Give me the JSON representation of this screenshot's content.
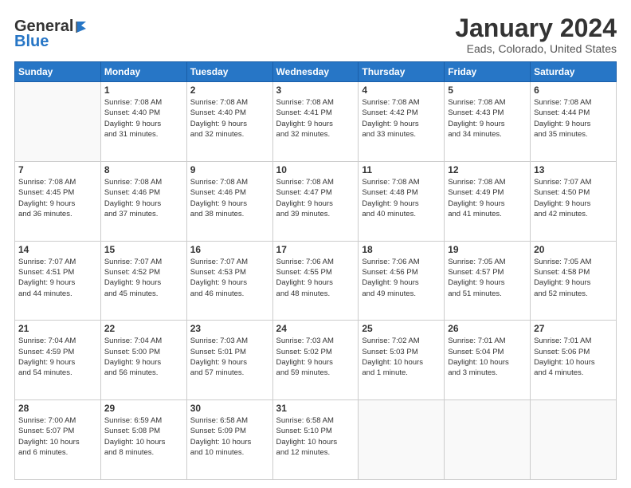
{
  "logo": {
    "general": "General",
    "blue": "Blue"
  },
  "title": "January 2024",
  "subtitle": "Eads, Colorado, United States",
  "days_header": [
    "Sunday",
    "Monday",
    "Tuesday",
    "Wednesday",
    "Thursday",
    "Friday",
    "Saturday"
  ],
  "weeks": [
    [
      {
        "num": "",
        "info": ""
      },
      {
        "num": "1",
        "info": "Sunrise: 7:08 AM\nSunset: 4:40 PM\nDaylight: 9 hours\nand 31 minutes."
      },
      {
        "num": "2",
        "info": "Sunrise: 7:08 AM\nSunset: 4:40 PM\nDaylight: 9 hours\nand 32 minutes."
      },
      {
        "num": "3",
        "info": "Sunrise: 7:08 AM\nSunset: 4:41 PM\nDaylight: 9 hours\nand 32 minutes."
      },
      {
        "num": "4",
        "info": "Sunrise: 7:08 AM\nSunset: 4:42 PM\nDaylight: 9 hours\nand 33 minutes."
      },
      {
        "num": "5",
        "info": "Sunrise: 7:08 AM\nSunset: 4:43 PM\nDaylight: 9 hours\nand 34 minutes."
      },
      {
        "num": "6",
        "info": "Sunrise: 7:08 AM\nSunset: 4:44 PM\nDaylight: 9 hours\nand 35 minutes."
      }
    ],
    [
      {
        "num": "7",
        "info": "Sunrise: 7:08 AM\nSunset: 4:45 PM\nDaylight: 9 hours\nand 36 minutes."
      },
      {
        "num": "8",
        "info": "Sunrise: 7:08 AM\nSunset: 4:46 PM\nDaylight: 9 hours\nand 37 minutes."
      },
      {
        "num": "9",
        "info": "Sunrise: 7:08 AM\nSunset: 4:46 PM\nDaylight: 9 hours\nand 38 minutes."
      },
      {
        "num": "10",
        "info": "Sunrise: 7:08 AM\nSunset: 4:47 PM\nDaylight: 9 hours\nand 39 minutes."
      },
      {
        "num": "11",
        "info": "Sunrise: 7:08 AM\nSunset: 4:48 PM\nDaylight: 9 hours\nand 40 minutes."
      },
      {
        "num": "12",
        "info": "Sunrise: 7:08 AM\nSunset: 4:49 PM\nDaylight: 9 hours\nand 41 minutes."
      },
      {
        "num": "13",
        "info": "Sunrise: 7:07 AM\nSunset: 4:50 PM\nDaylight: 9 hours\nand 42 minutes."
      }
    ],
    [
      {
        "num": "14",
        "info": "Sunrise: 7:07 AM\nSunset: 4:51 PM\nDaylight: 9 hours\nand 44 minutes."
      },
      {
        "num": "15",
        "info": "Sunrise: 7:07 AM\nSunset: 4:52 PM\nDaylight: 9 hours\nand 45 minutes."
      },
      {
        "num": "16",
        "info": "Sunrise: 7:07 AM\nSunset: 4:53 PM\nDaylight: 9 hours\nand 46 minutes."
      },
      {
        "num": "17",
        "info": "Sunrise: 7:06 AM\nSunset: 4:55 PM\nDaylight: 9 hours\nand 48 minutes."
      },
      {
        "num": "18",
        "info": "Sunrise: 7:06 AM\nSunset: 4:56 PM\nDaylight: 9 hours\nand 49 minutes."
      },
      {
        "num": "19",
        "info": "Sunrise: 7:05 AM\nSunset: 4:57 PM\nDaylight: 9 hours\nand 51 minutes."
      },
      {
        "num": "20",
        "info": "Sunrise: 7:05 AM\nSunset: 4:58 PM\nDaylight: 9 hours\nand 52 minutes."
      }
    ],
    [
      {
        "num": "21",
        "info": "Sunrise: 7:04 AM\nSunset: 4:59 PM\nDaylight: 9 hours\nand 54 minutes."
      },
      {
        "num": "22",
        "info": "Sunrise: 7:04 AM\nSunset: 5:00 PM\nDaylight: 9 hours\nand 56 minutes."
      },
      {
        "num": "23",
        "info": "Sunrise: 7:03 AM\nSunset: 5:01 PM\nDaylight: 9 hours\nand 57 minutes."
      },
      {
        "num": "24",
        "info": "Sunrise: 7:03 AM\nSunset: 5:02 PM\nDaylight: 9 hours\nand 59 minutes."
      },
      {
        "num": "25",
        "info": "Sunrise: 7:02 AM\nSunset: 5:03 PM\nDaylight: 10 hours\nand 1 minute."
      },
      {
        "num": "26",
        "info": "Sunrise: 7:01 AM\nSunset: 5:04 PM\nDaylight: 10 hours\nand 3 minutes."
      },
      {
        "num": "27",
        "info": "Sunrise: 7:01 AM\nSunset: 5:06 PM\nDaylight: 10 hours\nand 4 minutes."
      }
    ],
    [
      {
        "num": "28",
        "info": "Sunrise: 7:00 AM\nSunset: 5:07 PM\nDaylight: 10 hours\nand 6 minutes."
      },
      {
        "num": "29",
        "info": "Sunrise: 6:59 AM\nSunset: 5:08 PM\nDaylight: 10 hours\nand 8 minutes."
      },
      {
        "num": "30",
        "info": "Sunrise: 6:58 AM\nSunset: 5:09 PM\nDaylight: 10 hours\nand 10 minutes."
      },
      {
        "num": "31",
        "info": "Sunrise: 6:58 AM\nSunset: 5:10 PM\nDaylight: 10 hours\nand 12 minutes."
      },
      {
        "num": "",
        "info": ""
      },
      {
        "num": "",
        "info": ""
      },
      {
        "num": "",
        "info": ""
      }
    ]
  ]
}
